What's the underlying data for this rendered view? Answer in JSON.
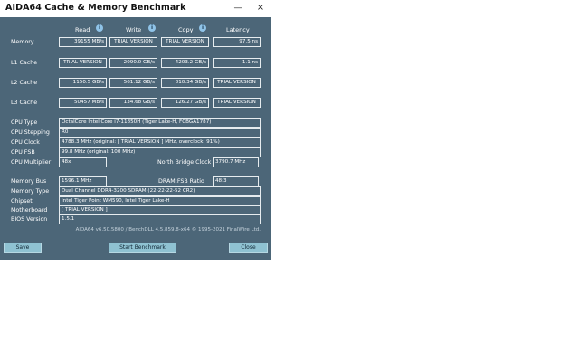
{
  "window": {
    "title": "AIDA64 Cache & Memory Benchmark",
    "minimize_glyph": "—",
    "close_glyph": "×"
  },
  "columns": {
    "read": "Read",
    "write": "Write",
    "copy": "Copy",
    "latency": "Latency"
  },
  "info_glyph": "i",
  "rows": [
    {
      "label": "Memory",
      "read": "39155 MB/s",
      "write": "TRIAL VERSION",
      "copy": "TRIAL VERSION",
      "latency": "97.5 ns"
    },
    {
      "label": "L1 Cache",
      "read": "TRIAL VERSION",
      "write": "2090.0 GB/s",
      "copy": "4203.2 GB/s",
      "latency": "1.1 ns"
    },
    {
      "label": "L2 Cache",
      "read": "1150.5 GB/s",
      "write": "561.12 GB/s",
      "copy": "810.34 GB/s",
      "latency": "TRIAL VERSION"
    },
    {
      "label": "L3 Cache",
      "read": "50457 MB/s",
      "write": "134.68 GB/s",
      "copy": "126.27 GB/s",
      "latency": "TRIAL VERSION"
    }
  ],
  "cpu": {
    "type_label": "CPU Type",
    "type": "OctalCore Intel Core i7-11850H  (Tiger Lake-H, FCBGA1787)",
    "stepping_label": "CPU Stepping",
    "stepping": "R0",
    "clock_label": "CPU Clock",
    "clock": "4788.3 MHz  (original: [ TRIAL VERSION ] MHz, overclock: 91%)",
    "fsb_label": "CPU FSB",
    "fsb": "99.8 MHz  (original: 100 MHz)",
    "multiplier_label": "CPU Multiplier",
    "multiplier": "48x",
    "nb_clock_label": "North Bridge Clock",
    "nb_clock": "3790.7 MHz"
  },
  "memory": {
    "bus_label": "Memory Bus",
    "bus": "1596.1 MHz",
    "ratio_label": "DRAM:FSB Ratio",
    "ratio": "48:3",
    "type_label": "Memory Type",
    "type": "Dual Channel DDR4-3200 SDRAM  (22-22-22-52 CR2)",
    "chipset_label": "Chipset",
    "chipset": "Intel Tiger Point WM590, Intel Tiger Lake-H",
    "motherboard_label": "Motherboard",
    "motherboard": "[ TRIAL VERSION ]",
    "bios_label": "BIOS Version",
    "bios": "1.5.1"
  },
  "footer": "AIDA64 v6.50.5800 / BenchDLL 4.5.859.8-x64  © 1995-2021 FinalWire Ltd.",
  "buttons": {
    "save": "Save",
    "start": "Start Benchmark",
    "close": "Close"
  }
}
